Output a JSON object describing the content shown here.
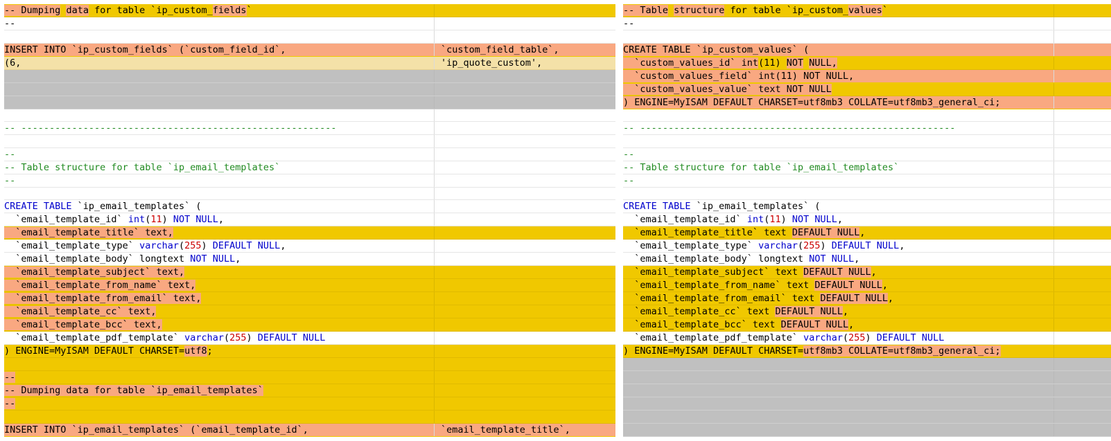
{
  "colors": {
    "changed_line": "#f0c800",
    "changed_text": "#f9a881",
    "missing_line": "#c0c0c0",
    "partial_line": "#f4e1a8",
    "keyword": "#0000cc",
    "number": "#cc0000",
    "comment": "#228b22"
  },
  "left": {
    "rows": [
      {
        "kind": "hl",
        "c1": [
          {
            "t": "-- ",
            "d": 1
          },
          {
            "t": "Dumping",
            "d": 1
          },
          {
            "t": " "
          },
          {
            "t": "data",
            "d": 1
          },
          {
            "t": " "
          },
          {
            "t": "for table `ip_custom_",
            "d": 0
          },
          {
            "t": "fields",
            "d": 1
          },
          {
            "t": "`"
          }
        ],
        "c2": []
      },
      {
        "kind": "",
        "c1": [
          {
            "t": "--",
            "s": "t"
          }
        ],
        "c2": []
      },
      {
        "kind": "empty",
        "c1": [],
        "c2": []
      },
      {
        "kind": "pk",
        "c1": [
          {
            "t": "INSERT",
            "d": 1
          },
          {
            "t": " "
          },
          {
            "t": "INTO",
            "d": 1
          },
          {
            "t": " "
          },
          {
            "t": "`ip_custom_",
            "d": 1
          },
          {
            "t": "fields",
            "d": 1
          },
          {
            "t": "` (`custom_field_id`,",
            "d": 1
          }
        ],
        "c2": [
          {
            "t": "`custom_field_table`,",
            "d": 1
          }
        ]
      },
      {
        "kind": "lt",
        "c1": [
          {
            "t": "(6,",
            "d": 0
          }
        ],
        "c2": [
          {
            "t": "'ip_quote_custom',",
            "d": 0
          }
        ]
      },
      {
        "kind": "gray",
        "c1": [],
        "c2": []
      },
      {
        "kind": "gray",
        "c1": [],
        "c2": []
      },
      {
        "kind": "gray",
        "c1": [],
        "c2": []
      },
      {
        "kind": "empty",
        "c1": [],
        "c2": []
      },
      {
        "kind": "",
        "c1": [
          {
            "t": "-- --------------------------------------------------------",
            "s": "cm"
          }
        ],
        "c2": []
      },
      {
        "kind": "empty",
        "c1": [],
        "c2": []
      },
      {
        "kind": "",
        "c1": [
          {
            "t": "--",
            "s": "cm"
          }
        ],
        "c2": []
      },
      {
        "kind": "",
        "c1": [
          {
            "t": "-- Table structure for table `ip_email_templates`",
            "s": "cm"
          }
        ],
        "c2": []
      },
      {
        "kind": "",
        "c1": [
          {
            "t": "--",
            "s": "cm"
          }
        ],
        "c2": []
      },
      {
        "kind": "empty",
        "c1": [],
        "c2": []
      },
      {
        "kind": "",
        "c1": [
          {
            "t": "CREATE TABLE",
            "s": "kw"
          },
          {
            "t": " `ip_email_templates` (",
            "s": "t"
          }
        ],
        "c2": []
      },
      {
        "kind": "",
        "c1": [
          {
            "t": "  `email_template_id` ",
            "s": "t"
          },
          {
            "t": "int",
            "s": "kw"
          },
          {
            "t": "(",
            "s": "t"
          },
          {
            "t": "11",
            "s": "num"
          },
          {
            "t": ") ",
            "s": "t"
          },
          {
            "t": "NOT NULL",
            "s": "kw"
          },
          {
            "t": ",",
            "s": "t"
          }
        ],
        "c2": []
      },
      {
        "kind": "hl",
        "c1": [
          {
            "t": "  `email_template_title` text,",
            "d": 1
          }
        ],
        "c2": []
      },
      {
        "kind": "",
        "c1": [
          {
            "t": "  `email_template_type` ",
            "s": "t"
          },
          {
            "t": "varchar",
            "s": "kw"
          },
          {
            "t": "(",
            "s": "t"
          },
          {
            "t": "255",
            "s": "num"
          },
          {
            "t": ") ",
            "s": "t"
          },
          {
            "t": "DEFAULT NULL",
            "s": "kw"
          },
          {
            "t": ",",
            "s": "t"
          }
        ],
        "c2": []
      },
      {
        "kind": "",
        "c1": [
          {
            "t": "  `email_template_body` longtext ",
            "s": "t"
          },
          {
            "t": "NOT NULL",
            "s": "kw"
          },
          {
            "t": ",",
            "s": "t"
          }
        ],
        "c2": []
      },
      {
        "kind": "hl",
        "c1": [
          {
            "t": "  `email_template_subject` text,",
            "d": 1
          }
        ],
        "c2": []
      },
      {
        "kind": "hl",
        "c1": [
          {
            "t": "  `email_template_from_name` text,",
            "d": 1
          }
        ],
        "c2": []
      },
      {
        "kind": "hl",
        "c1": [
          {
            "t": "  `email_template_from_email` text,",
            "d": 1
          }
        ],
        "c2": []
      },
      {
        "kind": "hl",
        "c1": [
          {
            "t": "  `email_template_cc` text,",
            "d": 1
          }
        ],
        "c2": []
      },
      {
        "kind": "hl",
        "c1": [
          {
            "t": "  `email_template_bcc` text,",
            "d": 1
          }
        ],
        "c2": []
      },
      {
        "kind": "",
        "c1": [
          {
            "t": "  `email_template_pdf_template` ",
            "s": "t"
          },
          {
            "t": "varchar",
            "s": "kw"
          },
          {
            "t": "(",
            "s": "t"
          },
          {
            "t": "255",
            "s": "num"
          },
          {
            "t": ") ",
            "s": "t"
          },
          {
            "t": "DEFAULT NULL",
            "s": "kw"
          }
        ],
        "c2": []
      },
      {
        "kind": "hl",
        "c1": [
          {
            "t": ") ENGINE=MyISAM ",
            "d": 0
          },
          {
            "t": "DEFAULT",
            "d": 0
          },
          {
            "t": " CHARSET=",
            "d": 0
          },
          {
            "t": "utf8",
            "d": 1
          },
          {
            "t": ";",
            "d": 0
          }
        ],
        "c2": []
      },
      {
        "kind": "hl",
        "c1": [],
        "c2": []
      },
      {
        "kind": "hl",
        "c1": [
          {
            "t": "--",
            "d": 1
          }
        ],
        "c2": []
      },
      {
        "kind": "hl",
        "c1": [
          {
            "t": "-- Dumping data for table `ip_email_templates`",
            "d": 1
          }
        ],
        "c2": []
      },
      {
        "kind": "hl",
        "c1": [
          {
            "t": "--",
            "d": 1
          }
        ],
        "c2": []
      },
      {
        "kind": "hl",
        "c1": [],
        "c2": []
      },
      {
        "kind": "pk",
        "c1": [
          {
            "t": "INSERT INTO `ip_email_templates` (`email_template_id`,",
            "d": 1
          }
        ],
        "c2": [
          {
            "t": "`email_template_title`,",
            "d": 1
          }
        ]
      }
    ]
  },
  "right": {
    "rows": [
      {
        "kind": "hl",
        "c1": [
          {
            "t": "-- ",
            "d": 1
          },
          {
            "t": "Table",
            "d": 1
          },
          {
            "t": " "
          },
          {
            "t": "structure",
            "d": 1
          },
          {
            "t": " "
          },
          {
            "t": "for table `ip_custom_",
            "d": 0
          },
          {
            "t": "values",
            "d": 1
          },
          {
            "t": "`"
          }
        ],
        "c2": []
      },
      {
        "kind": "",
        "c1": [
          {
            "t": "--",
            "s": "t"
          }
        ],
        "c2": []
      },
      {
        "kind": "empty",
        "c1": [],
        "c2": []
      },
      {
        "kind": "pk",
        "c1": [
          {
            "t": "CREATE",
            "d": 1
          },
          {
            "t": " "
          },
          {
            "t": "TABLE",
            "d": 1
          },
          {
            "t": " "
          },
          {
            "t": "`ip_custom_",
            "d": 1
          },
          {
            "t": "values",
            "d": 1
          },
          {
            "t": "` (",
            "d": 1
          }
        ],
        "c2": []
      },
      {
        "kind": "hl",
        "c1": [
          {
            "t": "  `custom_values_id` int",
            "d": 1
          },
          {
            "t": "(11)"
          },
          {
            "t": " "
          },
          {
            "t": "NOT",
            "d": 1
          },
          {
            "t": " "
          },
          {
            "t": "NULL,",
            "d": 1
          }
        ],
        "c2": []
      },
      {
        "kind": "pk",
        "c1": [
          {
            "t": "  `custom_values_field` int(11) NOT NULL,",
            "d": 1
          }
        ],
        "c2": []
      },
      {
        "kind": "hl",
        "c1": [
          {
            "t": "  `custom_values_value` text NOT NULL",
            "d": 1
          }
        ],
        "c2": []
      },
      {
        "kind": "pk",
        "c1": [
          {
            "t": ") ENGINE=MyISAM DEFAULT CHARSET=utf8mb3 COLLATE=utf8mb3_general_ci;",
            "d": 1
          }
        ],
        "c2": []
      },
      {
        "kind": "empty",
        "c1": [],
        "c2": []
      },
      {
        "kind": "",
        "c1": [
          {
            "t": "-- --------------------------------------------------------",
            "s": "cm"
          }
        ],
        "c2": []
      },
      {
        "kind": "empty",
        "c1": [],
        "c2": []
      },
      {
        "kind": "",
        "c1": [
          {
            "t": "--",
            "s": "cm"
          }
        ],
        "c2": []
      },
      {
        "kind": "",
        "c1": [
          {
            "t": "-- Table structure for table `ip_email_templates`",
            "s": "cm"
          }
        ],
        "c2": []
      },
      {
        "kind": "",
        "c1": [
          {
            "t": "--",
            "s": "cm"
          }
        ],
        "c2": []
      },
      {
        "kind": "empty",
        "c1": [],
        "c2": []
      },
      {
        "kind": "",
        "c1": [
          {
            "t": "CREATE TABLE",
            "s": "kw"
          },
          {
            "t": " `ip_email_templates` (",
            "s": "t"
          }
        ],
        "c2": []
      },
      {
        "kind": "",
        "c1": [
          {
            "t": "  `email_template_id` ",
            "s": "t"
          },
          {
            "t": "int",
            "s": "kw"
          },
          {
            "t": "(",
            "s": "t"
          },
          {
            "t": "11",
            "s": "num"
          },
          {
            "t": ") ",
            "s": "t"
          },
          {
            "t": "NOT NULL",
            "s": "kw"
          },
          {
            "t": ",",
            "s": "t"
          }
        ],
        "c2": []
      },
      {
        "kind": "hl",
        "c1": [
          {
            "t": "  `email_template_title` text "
          },
          {
            "t": "DEFAULT NULL",
            "d": 1
          },
          {
            "t": ","
          }
        ],
        "c2": []
      },
      {
        "kind": "",
        "c1": [
          {
            "t": "  `email_template_type` ",
            "s": "t"
          },
          {
            "t": "varchar",
            "s": "kw"
          },
          {
            "t": "(",
            "s": "t"
          },
          {
            "t": "255",
            "s": "num"
          },
          {
            "t": ") ",
            "s": "t"
          },
          {
            "t": "DEFAULT NULL",
            "s": "kw"
          },
          {
            "t": ",",
            "s": "t"
          }
        ],
        "c2": []
      },
      {
        "kind": "",
        "c1": [
          {
            "t": "  `email_template_body` longtext ",
            "s": "t"
          },
          {
            "t": "NOT NULL",
            "s": "kw"
          },
          {
            "t": ",",
            "s": "t"
          }
        ],
        "c2": []
      },
      {
        "kind": "hl",
        "c1": [
          {
            "t": "  `email_template_subject` text "
          },
          {
            "t": "DEFAULT NULL",
            "d": 1
          },
          {
            "t": ","
          }
        ],
        "c2": []
      },
      {
        "kind": "hl",
        "c1": [
          {
            "t": "  `email_template_from_name` text "
          },
          {
            "t": "DEFAULT NULL",
            "d": 1
          },
          {
            "t": ","
          }
        ],
        "c2": []
      },
      {
        "kind": "hl",
        "c1": [
          {
            "t": "  `email_template_from_email` text "
          },
          {
            "t": "DEFAULT NULL",
            "d": 1
          },
          {
            "t": ","
          }
        ],
        "c2": []
      },
      {
        "kind": "hl",
        "c1": [
          {
            "t": "  `email_template_cc` text "
          },
          {
            "t": "DEFAULT NULL",
            "d": 1
          },
          {
            "t": ","
          }
        ],
        "c2": []
      },
      {
        "kind": "hl",
        "c1": [
          {
            "t": "  `email_template_bcc` text "
          },
          {
            "t": "DEFAULT NULL",
            "d": 1
          },
          {
            "t": ","
          }
        ],
        "c2": []
      },
      {
        "kind": "",
        "c1": [
          {
            "t": "  `email_template_pdf_template` ",
            "s": "t"
          },
          {
            "t": "varchar",
            "s": "kw"
          },
          {
            "t": "(",
            "s": "t"
          },
          {
            "t": "255",
            "s": "num"
          },
          {
            "t": ") ",
            "s": "t"
          },
          {
            "t": "DEFAULT NULL",
            "s": "kw"
          }
        ],
        "c2": []
      },
      {
        "kind": "hl",
        "c1": [
          {
            "t": ") ENGINE=MyISAM "
          },
          {
            "t": "DEFAULT"
          },
          {
            "t": " CHARSET="
          },
          {
            "t": "utf8mb3 COLLATE=",
            "d": 1
          },
          {
            "t": "utf8mb3_general_ci;",
            "d": 1
          }
        ],
        "c2": []
      },
      {
        "kind": "gray",
        "c1": [],
        "c2": []
      },
      {
        "kind": "gray",
        "c1": [],
        "c2": []
      },
      {
        "kind": "gray",
        "c1": [],
        "c2": []
      },
      {
        "kind": "gray",
        "c1": [],
        "c2": []
      },
      {
        "kind": "gray",
        "c1": [],
        "c2": []
      },
      {
        "kind": "gray",
        "c1": [],
        "c2": []
      }
    ]
  }
}
